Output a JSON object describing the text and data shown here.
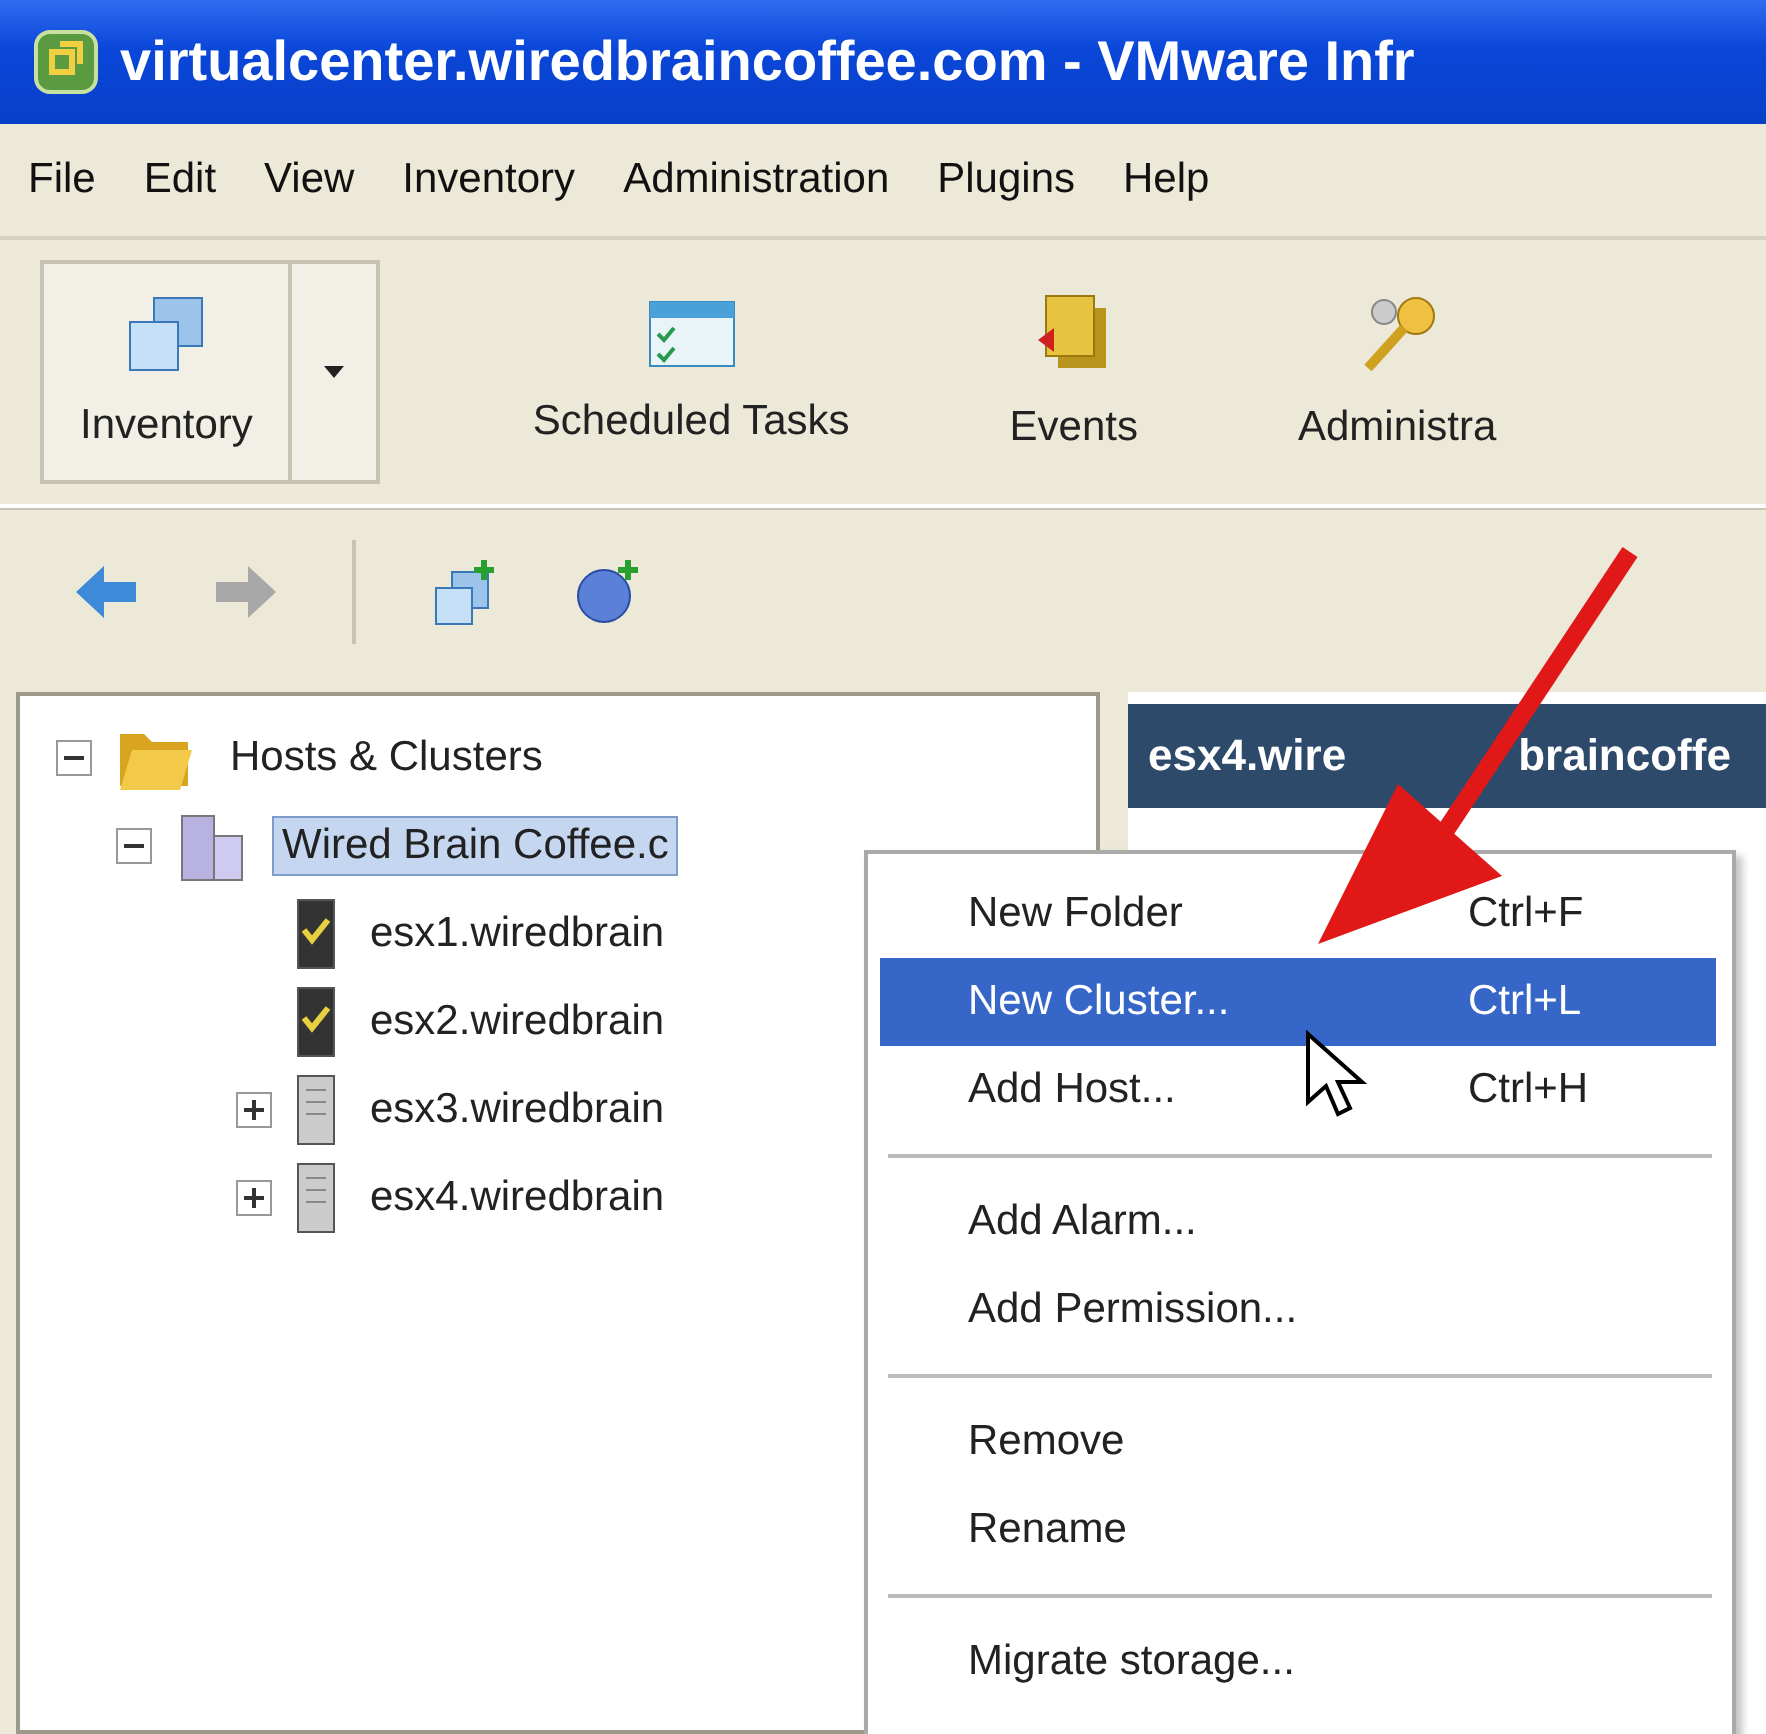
{
  "window": {
    "title": "virtualcenter.wiredbraincoffee.com - VMware Infr"
  },
  "menu_bar": [
    "File",
    "Edit",
    "View",
    "Inventory",
    "Administration",
    "Plugins",
    "Help"
  ],
  "toolbar": [
    {
      "label": "Inventory",
      "kind": "inventory",
      "selected": true
    },
    {
      "label": "Scheduled Tasks",
      "kind": "tasks",
      "selected": false
    },
    {
      "label": "Events",
      "kind": "events",
      "selected": false
    },
    {
      "label": "Administra",
      "kind": "admin",
      "selected": false
    }
  ],
  "tree": {
    "label": "Hosts & Clusters",
    "expanded": true,
    "children": [
      {
        "label": "Wired Brain Coffee.c",
        "expanded": true,
        "selected": true,
        "children": [
          {
            "label": "esx1.wiredbrain",
            "kind": "ok",
            "expandable": false
          },
          {
            "label": "esx2.wiredbrain",
            "kind": "ok",
            "expandable": false
          },
          {
            "label": "esx3.wiredbrain",
            "kind": "plain",
            "expandable": true
          },
          {
            "label": "esx4.wiredbrain",
            "kind": "plain",
            "expandable": true
          }
        ]
      }
    ]
  },
  "detail_header": [
    "esx4.wire",
    "braincoffe"
  ],
  "context_menu": [
    [
      {
        "label": "New Folder",
        "shortcut": "Ctrl+F",
        "selected": false
      },
      {
        "label": "New Cluster...",
        "shortcut": "Ctrl+L",
        "selected": true
      },
      {
        "label": "Add Host...",
        "shortcut": "Ctrl+H",
        "selected": false
      }
    ],
    [
      {
        "label": "Add Alarm...",
        "selected": false
      },
      {
        "label": "Add Permission...",
        "selected": false
      }
    ],
    [
      {
        "label": "Remove",
        "selected": false
      },
      {
        "label": "Rename",
        "selected": false
      }
    ],
    [
      {
        "label": "Migrate storage...",
        "selected": false
      }
    ]
  ]
}
